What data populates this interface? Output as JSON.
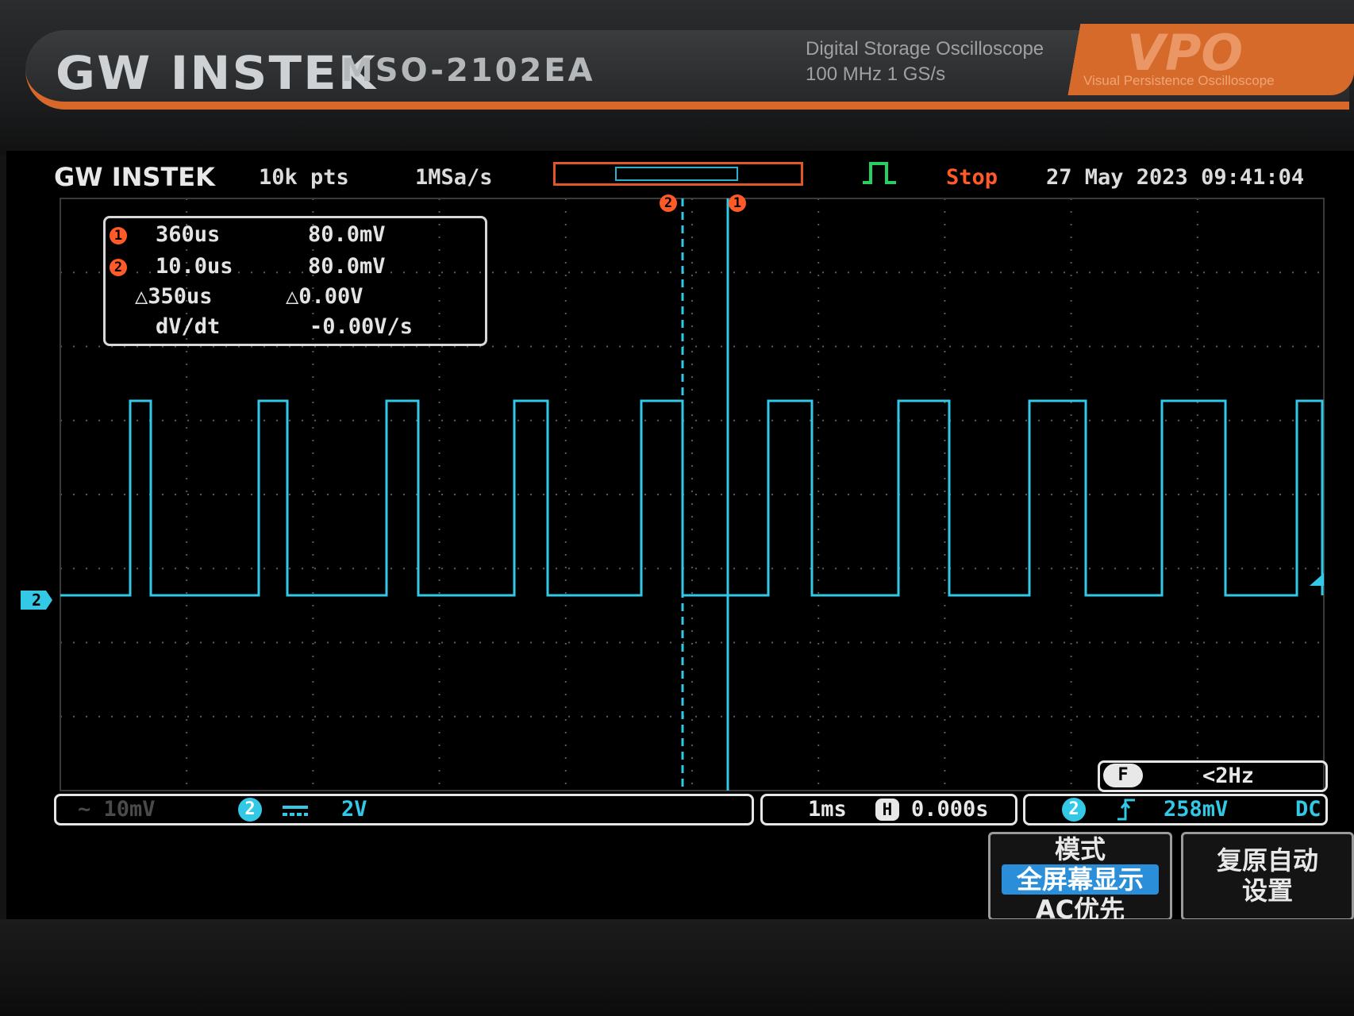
{
  "device": {
    "brand": "GW INSTEK",
    "model": "MSO-2102EA",
    "spec_line1": "Digital  Storage  Oscilloscope",
    "spec_line2": "100 MHz   1 GS/s",
    "vpo_logo": "VPO",
    "vpo_subtitle": "Visual Persistence Oscilloscope"
  },
  "header": {
    "logo": "GW INSTEK",
    "record_length": "10k pts",
    "sample_rate": "1MSa/s",
    "run_state": "Stop",
    "datetime": "27 May 2023 09:41:04"
  },
  "cursors": {
    "c1_marker": "1",
    "c2_marker": "2",
    "c1_time": "360us",
    "c1_volt": "80.0mV",
    "c2_time": "10.0us",
    "c2_volt": "80.0mV",
    "delta_time": "△350us",
    "delta_volt": "△0.00V",
    "dvdt_label": "dV/dt",
    "dvdt_value": "-0.00V/s"
  },
  "channel_bar": {
    "ch1_faded": "~  10mV",
    "ch2_badge": "2",
    "ch2_coupling_icon": "dc-coupling-icon",
    "ch2_scale": "2V"
  },
  "timebase": {
    "scale": "1ms",
    "h_icon": "H",
    "position": "0.000s"
  },
  "trigger": {
    "freq_badge": "F",
    "frequency": "<2Hz",
    "source_badge": "2",
    "slope_icon": "rising-edge-icon",
    "level": "258mV",
    "coupling": "DC"
  },
  "waveform": {
    "channel": "2",
    "color": "#32c8e6",
    "high_level_div": 2.5,
    "low_level_div": 0
  },
  "softkeys": {
    "mode_title": "模式",
    "mode_selected": "全屏幕显示",
    "mode_option": "AC优先",
    "reset_line1": "复原自动",
    "reset_line2": "设置"
  },
  "colors": {
    "accent": "#d8682a",
    "trace": "#32c8e6",
    "stop": "#ff5a28",
    "cursor_badge": "#ff5a28"
  }
}
